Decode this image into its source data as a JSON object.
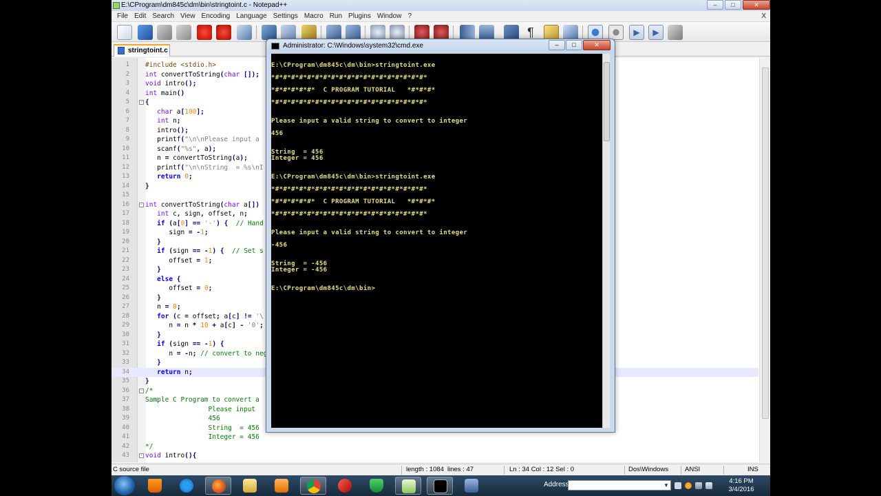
{
  "npp": {
    "title": "E:\\CProgram\\dm845c\\dm\\bin\\stringtoint.c - Notepad++",
    "menu": [
      "File",
      "Edit",
      "Search",
      "View",
      "Encoding",
      "Language",
      "Settings",
      "Macro",
      "Run",
      "Plugins",
      "Window",
      "?"
    ],
    "close_x": "X",
    "active_tab": "stringtoint.c",
    "status": {
      "file_type": "C source file",
      "length": "length : 1084",
      "lines": "lines : 47",
      "position": "Ln : 34    Col : 12    Sel : 0",
      "eol": "Dos\\Windows",
      "encoding": "ANSI",
      "mode": "INS"
    },
    "code_lines": [
      {
        "n": "1",
        "t": "#include <stdio.h>"
      },
      {
        "n": "2",
        "t": "int convertToString(char []);"
      },
      {
        "n": "3",
        "t": "void intro();"
      },
      {
        "n": "4",
        "t": "int main()"
      },
      {
        "n": "5",
        "t": "{"
      },
      {
        "n": "6",
        "t": "   char a[100];"
      },
      {
        "n": "7",
        "t": "   int n;"
      },
      {
        "n": "8",
        "t": "   intro();"
      },
      {
        "n": "9",
        "t": "   printf(\"\\n\\nPlease input a"
      },
      {
        "n": "10",
        "t": "   scanf(\"%s\", a);"
      },
      {
        "n": "11",
        "t": "   n = convertToString(a);"
      },
      {
        "n": "12",
        "t": "   printf(\"\\n\\nString  = %s\\nI"
      },
      {
        "n": "13",
        "t": "   return 0;"
      },
      {
        "n": "14",
        "t": "}"
      },
      {
        "n": "15",
        "t": ""
      },
      {
        "n": "16",
        "t": "int convertToString(char a[])"
      },
      {
        "n": "17",
        "t": "   int c, sign, offset, n;"
      },
      {
        "n": "18",
        "t": "   if (a[0] == '-') {  // Hand"
      },
      {
        "n": "19",
        "t": "      sign = -1;"
      },
      {
        "n": "20",
        "t": "   }"
      },
      {
        "n": "21",
        "t": "   if (sign == -1) {  // Set s"
      },
      {
        "n": "22",
        "t": "      offset = 1;"
      },
      {
        "n": "23",
        "t": "   }"
      },
      {
        "n": "24",
        "t": "   else {"
      },
      {
        "n": "25",
        "t": "      offset = 0;"
      },
      {
        "n": "26",
        "t": "   }"
      },
      {
        "n": "27",
        "t": "   n = 0;"
      },
      {
        "n": "28",
        "t": "   for (c = offset; a[c] != '\\"
      },
      {
        "n": "29",
        "t": "      n = n * 10 + a[c] - '0';"
      },
      {
        "n": "30",
        "t": "   }"
      },
      {
        "n": "31",
        "t": "   if (sign == -1) {"
      },
      {
        "n": "32",
        "t": "      n = -n; // convert to nega"
      },
      {
        "n": "33",
        "t": "   }"
      },
      {
        "n": "34",
        "t": "   return n;"
      },
      {
        "n": "35",
        "t": "}"
      },
      {
        "n": "36",
        "t": "/*"
      },
      {
        "n": "37",
        "t": "Sample C Program to convert a"
      },
      {
        "n": "38",
        "t": "                Please input"
      },
      {
        "n": "39",
        "t": "                456"
      },
      {
        "n": "40",
        "t": "                String  = 456"
      },
      {
        "n": "41",
        "t": "                Integer = 456"
      },
      {
        "n": "42",
        "t": "*/"
      },
      {
        "n": "43",
        "t": "void intro(){"
      }
    ]
  },
  "cmd": {
    "title": "Administrator: C:\\Windows\\system32\\cmd.exe",
    "lines": [
      "E:\\CProgram\\dm845c\\dm\\bin>stringtoint.exe",
      "",
      "*#*#*#*#*#*#*#*#*#*#*#*#*#*#*#*#*#*#*#*",
      "",
      "*#*#*#*#*#*  C PROGRAM TUTORIAL   *#*#*#*",
      "",
      "*#*#*#*#*#*#*#*#*#*#*#*#*#*#*#*#*#*#*#*",
      "",
      "Please input a valid string to convert to integer",
      "",
      "456",
      "",
      "",
      "String  = 456",
      "Integer = 456",
      "",
      "E:\\CProgram\\dm845c\\dm\\bin>stringtoint.exe",
      "",
      "*#*#*#*#*#*#*#*#*#*#*#*#*#*#*#*#*#*#*#*",
      "",
      "*#*#*#*#*#*  C PROGRAM TUTORIAL   *#*#*#*",
      "",
      "*#*#*#*#*#*#*#*#*#*#*#*#*#*#*#*#*#*#*#*",
      "",
      "Please input a valid string to convert to integer",
      "",
      "-456",
      "",
      "",
      "String  = -456",
      "Integer = -456",
      "",
      "E:\\CProgram\\dm845c\\dm\\bin>"
    ]
  },
  "taskbar": {
    "address_label": "Address",
    "time": "4:16 PM",
    "date": "3/4/2016",
    "apps": [
      "start-orb",
      "vlc-icon",
      "ie-icon",
      "firefox-icon",
      "explorer-icon",
      "media-player-icon",
      "chrome-icon",
      "red-app-icon",
      "shield-app-icon",
      "notepadpp-icon",
      "cmd-icon",
      "save-app-icon"
    ]
  },
  "colors": {
    "console_text": "#e8e07a",
    "console_bg": "#000000",
    "keyword": "#0000ff",
    "type": "#8000ff",
    "comment": "#008000",
    "number": "#ff8000",
    "current_line": "#e8e8ff"
  }
}
